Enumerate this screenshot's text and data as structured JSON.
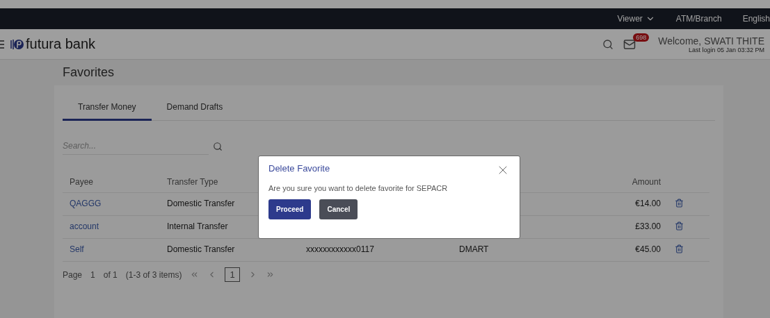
{
  "top_bar": {
    "items": [
      {
        "label": "Viewer",
        "kind": "dropdown"
      },
      {
        "label": "ATM/Branch",
        "kind": "link"
      },
      {
        "label": "English",
        "kind": "link"
      }
    ]
  },
  "header": {
    "brand": "futura bank",
    "mail_count": "698",
    "welcome": "Welcome, SWATI THITE",
    "last_login": "Last login 05 Jan 03:32 PM"
  },
  "page_title": "Favorites",
  "tabs": [
    {
      "label": "Transfer Money",
      "selected": true
    },
    {
      "label": "Demand Drafts",
      "selected": false
    }
  ],
  "search": {
    "placeholder": "Search..."
  },
  "table": {
    "columns": [
      "Payee",
      "Transfer Type",
      "",
      "",
      "Amount"
    ],
    "rows": [
      {
        "payee": "QAGGG",
        "transfer_type": "Domestic Transfer",
        "amount": "€14.00"
      },
      {
        "payee": "account",
        "transfer_type": "Internal Transfer",
        "amount": "£33.00"
      },
      {
        "payee": "Self",
        "transfer_type": "Domestic Transfer",
        "account": "xxxxxxxxxxxx0117",
        "nickname": "DMART",
        "amount": "€45.00"
      }
    ]
  },
  "pagination": {
    "page_label": "Page",
    "page": "1",
    "of_label": "of 1",
    "range": "(1-3 of 3 items)",
    "current": "1"
  },
  "dialog": {
    "title": "Delete Favorite",
    "message": "Are you sure you want to delete favorite for SEPACR",
    "buttons": [
      {
        "label": "Proceed",
        "kind": "primary"
      },
      {
        "label": "Cancel",
        "kind": "secondary"
      }
    ]
  }
}
